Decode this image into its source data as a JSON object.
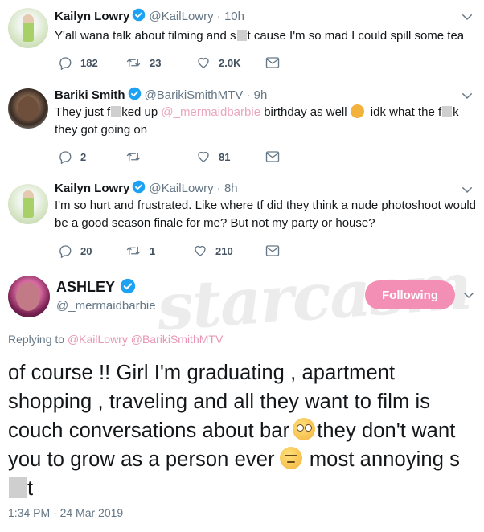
{
  "tweets": [
    {
      "name": "Kailyn Lowry",
      "handle": "@KailLowry",
      "dot": "·",
      "time": "10h",
      "text_parts": [
        "Y'all wana talk about filming and s",
        "t cause I'm so mad I could spill some tea"
      ],
      "replies": "182",
      "retweets": "23",
      "likes": "2.0K"
    },
    {
      "name": "Bariki Smith",
      "handle": "@BarikiSmithMTV",
      "dot": "·",
      "time": "9h",
      "text_a": "They just f",
      "text_b": "ked up ",
      "mention": "@_mermaidbarbie",
      "text_c": " birthday as well",
      "text_d": " idk what the f",
      "text_e": "k",
      "text_line2": "they got going on",
      "replies": "2",
      "retweets": "",
      "likes": "81"
    },
    {
      "name": "Kailyn Lowry",
      "handle": "@KailLowry",
      "dot": "·",
      "time": "8h",
      "text": "I'm so hurt and frustrated. Like where tf did they think a nude photoshoot would be a good season finale for me? But not my party or house?",
      "replies": "20",
      "retweets": "1",
      "likes": "210"
    }
  ],
  "main_tweet": {
    "name": "ASHLEY",
    "handle": "@_mermaidbarbie",
    "follow_label": "Following",
    "replying_prefix": "Replying to ",
    "replying_to": "@KailLowry @BarikiSmithMTV",
    "text_1": "of course !! Girl I'm graduating , apartment shopping , traveling and all they want to film is couch conversations about bar",
    "text_2": "they don't want you to grow as a person ever",
    "text_3": "most annoying s",
    "text_4": "t",
    "timestamp": "1:34 PM - 24 Mar 2019"
  },
  "watermark": "starcasm",
  "colors": {
    "verified": "#1da1f2",
    "follow_button": "#f38fb5",
    "mention": "#e896b4",
    "meta": "#657786"
  },
  "icons": [
    "reply-icon",
    "retweet-icon",
    "like-icon",
    "message-icon",
    "verified-icon",
    "chevron-down-icon"
  ]
}
